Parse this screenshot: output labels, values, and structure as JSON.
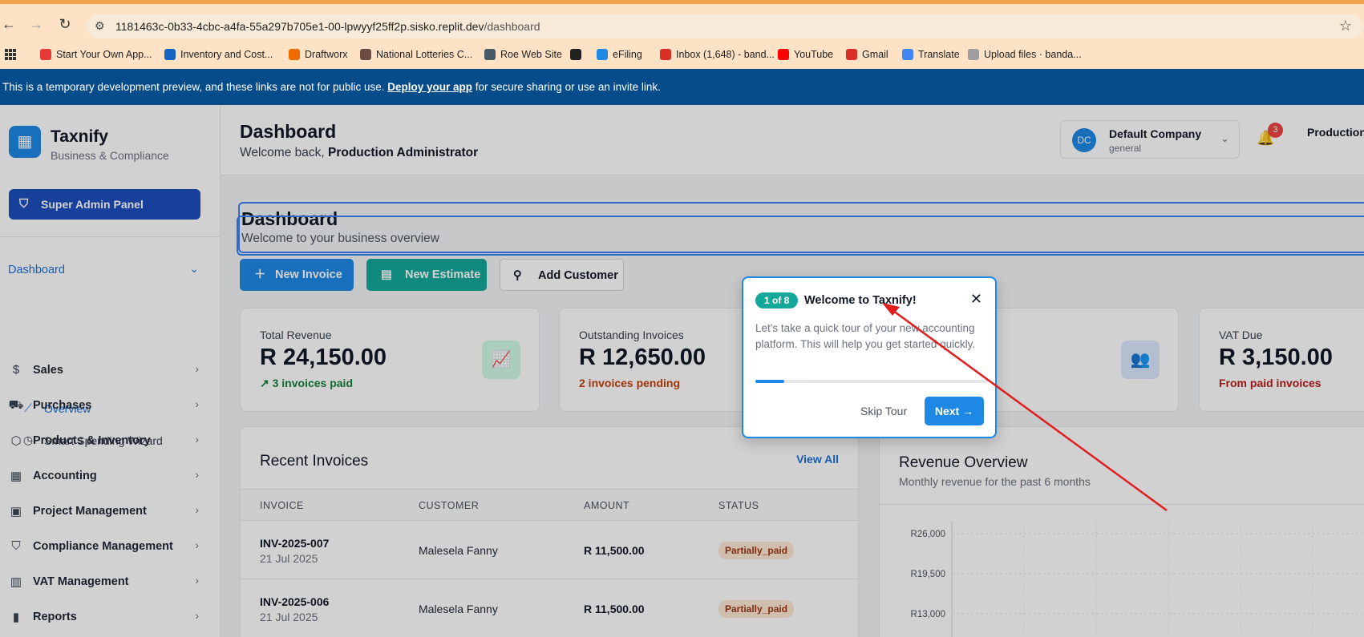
{
  "browser": {
    "url_host": "1181463c-0b33-4cbc-a4fa-55a297b705e1-00-lpwyyf25ff2p.sisko.replit.dev",
    "url_path": "/dashboard",
    "bookmarks": [
      {
        "label": "Start Your Own App...",
        "color": "#e53935"
      },
      {
        "label": "Inventory and Cost...",
        "color": "#1565c0"
      },
      {
        "label": "Draftworx",
        "color": "#ef6c00"
      },
      {
        "label": "National Lotteries C...",
        "color": "#6d4c41"
      },
      {
        "label": "Roe Web Site",
        "color": "#455a64"
      },
      {
        "label": "",
        "color": "#212121"
      },
      {
        "label": "eFiling",
        "color": "#1e88e5"
      },
      {
        "label": "Inbox (1,648) - band...",
        "color": "#d93025"
      },
      {
        "label": "YouTube",
        "color": "#ff0000"
      },
      {
        "label": "Gmail",
        "color": "#d93025"
      },
      {
        "label": "Translate",
        "color": "#4285f4"
      },
      {
        "label": "Upload files · banda...",
        "color": "#9e9e9e"
      }
    ]
  },
  "banner": {
    "text_before": "This is a temporary development preview, and these links are not for public use. ",
    "link": "Deploy your app",
    "text_after": " for secure sharing or use an invite link."
  },
  "sidebar": {
    "brand": "Taxnify",
    "brand_sub": "Business & Compliance",
    "admin_button": "Super Admin Panel",
    "dashboard_label": "Dashboard",
    "sub_items": [
      {
        "label": "Overview",
        "icon": "chart-line-icon"
      },
      {
        "label": "Smart Spending Wizard",
        "icon": "wizard-icon"
      }
    ],
    "items": [
      {
        "label": "Sales",
        "icon": "dollar-icon"
      },
      {
        "label": "Purchases",
        "icon": "truck-icon"
      },
      {
        "label": "Products & Inventory",
        "icon": "box-icon"
      },
      {
        "label": "Accounting",
        "icon": "calculator-icon"
      },
      {
        "label": "Project Management",
        "icon": "briefcase-icon"
      },
      {
        "label": "Compliance Management",
        "icon": "shield-icon"
      },
      {
        "label": "VAT Management",
        "icon": "receipt-icon"
      },
      {
        "label": "Reports",
        "icon": "bar-chart-icon"
      }
    ]
  },
  "header": {
    "title": "Dashboard",
    "welcome_prefix": "Welcome back, ",
    "welcome_name": "Production Administrator",
    "company_initials": "DC",
    "company_name": "Default Company",
    "company_type": "general",
    "notifications": "3",
    "user_name": "Production"
  },
  "page": {
    "title": "Dashboard",
    "subtitle": "Welcome to your business overview"
  },
  "actions": {
    "new_invoice": "New Invoice",
    "new_estimate": "New Estimate",
    "add_customer": "Add Customer"
  },
  "stats": [
    {
      "label": "Total Revenue",
      "value": "R 24,150.00",
      "note": "↗ 3 invoices paid",
      "note_color": "#15803d"
    },
    {
      "label": "Outstanding Invoices",
      "value": "R 12,650.00",
      "note": "2 invoices pending",
      "note_color": "#c2410c"
    },
    {
      "label": "VAT Due",
      "value": "R 3,150.00",
      "note": "From paid invoices",
      "note_color": "#b91c1c"
    }
  ],
  "invoices": {
    "title": "Recent Invoices",
    "view_all": "View All",
    "columns": [
      "INVOICE",
      "CUSTOMER",
      "AMOUNT",
      "STATUS"
    ],
    "rows": [
      {
        "number": "INV-2025-007",
        "date": "21 Jul 2025",
        "customer": "Malesela Fanny",
        "amount": "R 11,500.00",
        "status": "Partially_paid"
      },
      {
        "number": "INV-2025-006",
        "date": "21 Jul 2025",
        "customer": "Malesela Fanny",
        "amount": "R 11,500.00",
        "status": "Partially_paid"
      }
    ]
  },
  "revenue": {
    "title": "Revenue Overview",
    "subtitle": "Monthly revenue for the past 6 months"
  },
  "chart_data": {
    "type": "line",
    "title": "Revenue Overview",
    "y_ticks": [
      "R26,000",
      "R19,500",
      "R13,000"
    ],
    "y_tick_values": [
      26000,
      19500,
      13000
    ],
    "grid": true,
    "series": []
  },
  "tour": {
    "step": "1 of 8",
    "title": "Welcome to Taxnify!",
    "body": "Let's take a quick tour of your new accounting platform. This will help you get started quickly.",
    "progress": 0.125,
    "skip": "Skip Tour",
    "next": "Next →"
  }
}
